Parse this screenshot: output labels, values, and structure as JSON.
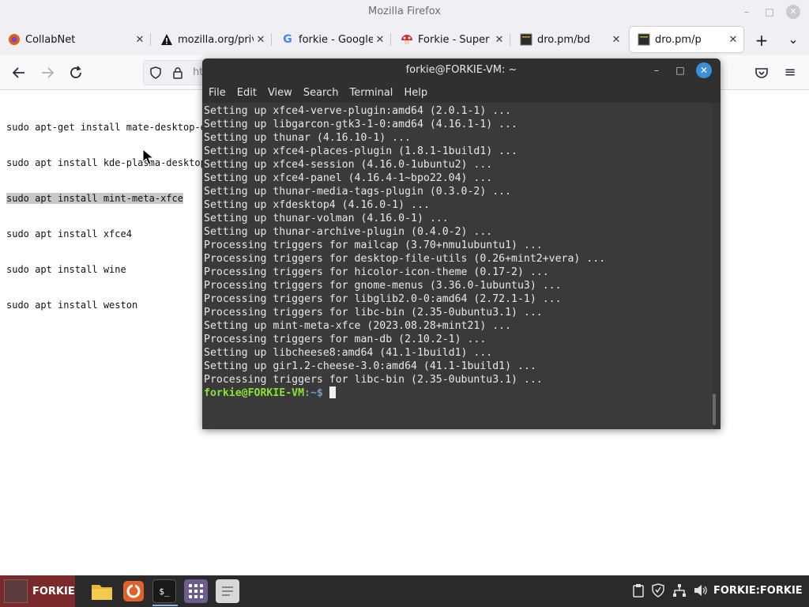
{
  "window": {
    "title": "Mozilla Firefox",
    "controls": {
      "minimize": "–",
      "maximize": "□",
      "close": "✕"
    }
  },
  "tabs": [
    {
      "label": "CollabNet",
      "icon": "firefox-icon",
      "color": "#e66000"
    },
    {
      "label": "mozilla.org/priv",
      "icon": "warning-icon",
      "color": "#15141a"
    },
    {
      "label": "forkie - Google",
      "icon": "google-icon",
      "color": "#4285f4"
    },
    {
      "label": "Forkie - Super M",
      "icon": "mushroom-icon",
      "color": "#d9262b"
    },
    {
      "label": "dro.pm/bd",
      "icon": "page-icon",
      "color": "#3a3a3a"
    },
    {
      "label": "dro.pm/p",
      "icon": "page-icon",
      "color": "#3a3a3a",
      "active": true
    }
  ],
  "toolbar": {
    "new_tab": "+",
    "list_tabs": "⌄",
    "url_prefix": "ht",
    "menu": "≡"
  },
  "page": {
    "lines": [
      "sudo apt-get install mate-desktop-e",
      "sudo apt install kde-plasma-desktop",
      "sudo apt install mint-meta-xfce",
      "sudo apt install xfce4",
      "sudo apt install wine",
      "sudo apt install weston"
    ],
    "selected_line": 2
  },
  "terminal": {
    "title": "forkie@FORKIE-VM: ~",
    "menu": [
      "File",
      "Edit",
      "View",
      "Search",
      "Terminal",
      "Help"
    ],
    "output": [
      "Setting up xfce4-verve-plugin:amd64 (2.0.1-1) ...",
      "Setting up libgarcon-gtk3-1-0:amd64 (4.16.1-1) ...",
      "Setting up thunar (4.16.10-1) ...",
      "Setting up xfce4-places-plugin (1.8.1-1build1) ...",
      "Setting up xfce4-session (4.16.0-1ubuntu2) ...",
      "Setting up xfce4-panel (4.16.4-1~bpo22.04) ...",
      "Setting up thunar-media-tags-plugin (0.3.0-2) ...",
      "Setting up xfdesktop4 (4.16.0-1) ...",
      "Setting up thunar-volman (4.16.0-1) ...",
      "Setting up thunar-archive-plugin (0.4.0-2) ...",
      "Processing triggers for mailcap (3.70+nmu1ubuntu1) ...",
      "Processing triggers for desktop-file-utils (0.26+mint2+vera) ...",
      "Processing triggers for hicolor-icon-theme (0.17-2) ...",
      "Processing triggers for gnome-menus (3.36.0-1ubuntu3) ...",
      "Processing triggers for libglib2.0-0:amd64 (2.72.1-1) ...",
      "Processing triggers for libc-bin (2.35-0ubuntu3.1) ...",
      "Setting up mint-meta-xfce (2023.08.28+mint21) ...",
      "Processing triggers for man-db (2.10.2-1) ...",
      "Setting up libcheese8:amd64 (41.1-1build1) ...",
      "Setting up gir1.2-cheese-3.0:amd64 (41.1-1build1) ...",
      "Processing triggers for libc-bin (2.35-0ubuntu3.1) ..."
    ],
    "prompt_user": "forkie@FORKIE-VM",
    "prompt_path": ":~$ "
  },
  "taskbar": {
    "start_label": "FORKIE",
    "apps": [
      {
        "name": "files-icon",
        "color": "#e8b43a"
      },
      {
        "name": "firefox-icon",
        "color": "#e0612b"
      },
      {
        "name": "terminal-icon",
        "color": "#1e1e1e"
      },
      {
        "name": "apps-grid-icon",
        "color": "#6d5a8f"
      },
      {
        "name": "text-editor-icon",
        "color": "#d8d8d8"
      }
    ],
    "tray_label": "FORKIE:FORKIE"
  }
}
